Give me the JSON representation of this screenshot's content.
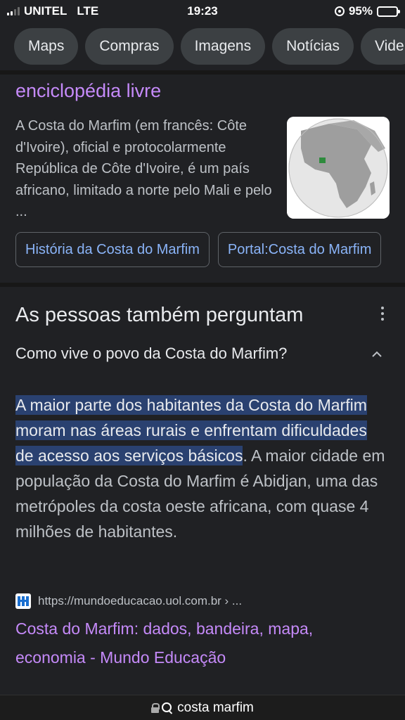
{
  "status_bar": {
    "carrier": "UNITEL",
    "network": "LTE",
    "time": "19:23",
    "battery": "95%",
    "battery_level": 0.95
  },
  "chips": [
    "Maps",
    "Compras",
    "Imagens",
    "Notícias",
    "Vide"
  ],
  "wiki_result": {
    "title": "enciclopédia livre",
    "snippet": "A Costa do Marfim (em francês: Côte d'Ivoire), oficial e protocolarmente República de Côte d'Ivoire, é um país africano, limitado a norte pelo Mali e pelo ...",
    "thumbnail_icon": "africa-globe-map",
    "related_links": [
      "História da Costa do Marfim",
      "Portal:Costa do Marfim"
    ]
  },
  "people_also_ask": {
    "title": "As pessoas também perguntam",
    "question": "Como vive o povo da Costa do Marfim?",
    "answer_highlight": "A maior parte dos habitantes da Costa do Marfim moram nas áreas rurais e enfrentam dificuldades de acesso aos serviços básicos",
    "answer_highlight_end": ".",
    "answer_rest": "A maior cidade em população da Costa do Marfim é Abidjan, uma das metrópoles da costa oeste africana, com quase 4 milhões de habitantes.",
    "source_url": "https://mundoeducacao.uol.com.br › ...",
    "result_title": "Costa do Marfim: dados, bandeira, mapa, economia - Mundo Educação"
  },
  "url_bar": {
    "query": "costa marfim"
  },
  "colors": {
    "background": "#202124",
    "link_visited": "#c58af9",
    "link": "#8ab4f8",
    "highlight": "#2a4170"
  }
}
